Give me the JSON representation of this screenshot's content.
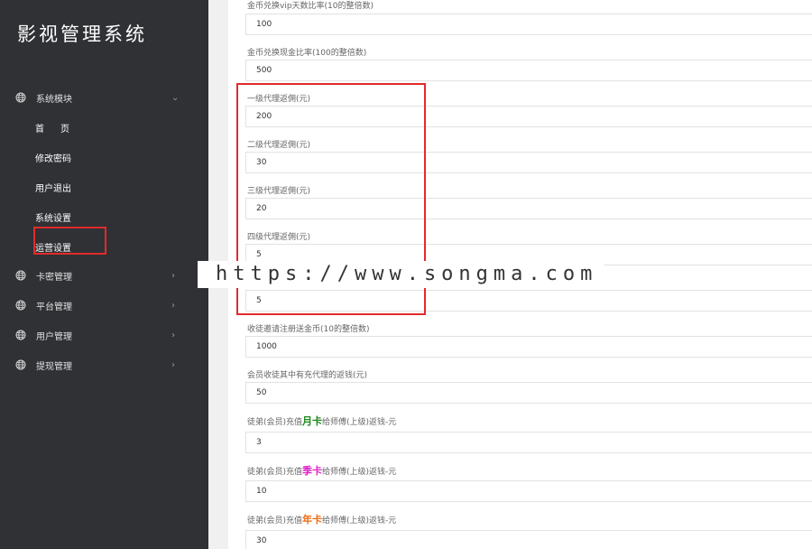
{
  "sidebar": {
    "title": "影视管理系统",
    "groups": [
      {
        "label": "系统模块",
        "chevron": "⌄",
        "icon": "globe-icon"
      },
      {
        "label": "卡密管理",
        "chevron": "›",
        "icon": "globe-icon"
      },
      {
        "label": "平台管理",
        "chevron": "›",
        "icon": "globe-icon"
      },
      {
        "label": "用户管理",
        "chevron": "›",
        "icon": "globe-icon"
      },
      {
        "label": "提现管理",
        "chevron": "›",
        "icon": "globe-icon"
      }
    ],
    "subitems": [
      "首页",
      "修改密码",
      "用户退出",
      "系统设置",
      "运营设置"
    ]
  },
  "form": {
    "fields": [
      {
        "label": "金币兑换vip天数比率(10的整倍数)",
        "value": "100"
      },
      {
        "label": "金币兑换现金比率(100的整倍数)",
        "value": "500"
      },
      {
        "label": "一级代理返佣(元)",
        "value": "200"
      },
      {
        "label": "二级代理返佣(元)",
        "value": "30"
      },
      {
        "label": "三级代理返佣(元)",
        "value": "20"
      },
      {
        "label": "四级代理返佣(元)",
        "value": "5"
      },
      {
        "label": "",
        "value": "5"
      },
      {
        "label": "收徒邀请注册送金币(10的整倍数)",
        "value": "1000"
      },
      {
        "label": "会员收徒其中有充代理的返钱(元)",
        "value": "50"
      }
    ],
    "tag_fields": [
      {
        "prefix": "徒弟(会员)充值",
        "tag": "月卡",
        "tag_color": "#1a8a1a",
        "suffix": "给师傅(上级)返钱-元",
        "value": "3"
      },
      {
        "prefix": "徒弟(会员)充值",
        "tag": "季卡",
        "tag_color": "#e020c8",
        "suffix": "给师傅(上级)返钱-元",
        "value": "10"
      },
      {
        "prefix": "徒弟(会员)充值",
        "tag": "年卡",
        "tag_color": "#f06a10",
        "suffix": "给师傅(上级)返钱-元",
        "value": "30"
      }
    ]
  },
  "watermark": "https://www.songma.com",
  "colors": {
    "sidebar_bg": "#2f3135",
    "highlight": "#e22b2b",
    "page_bg": "#f0f0f0"
  }
}
